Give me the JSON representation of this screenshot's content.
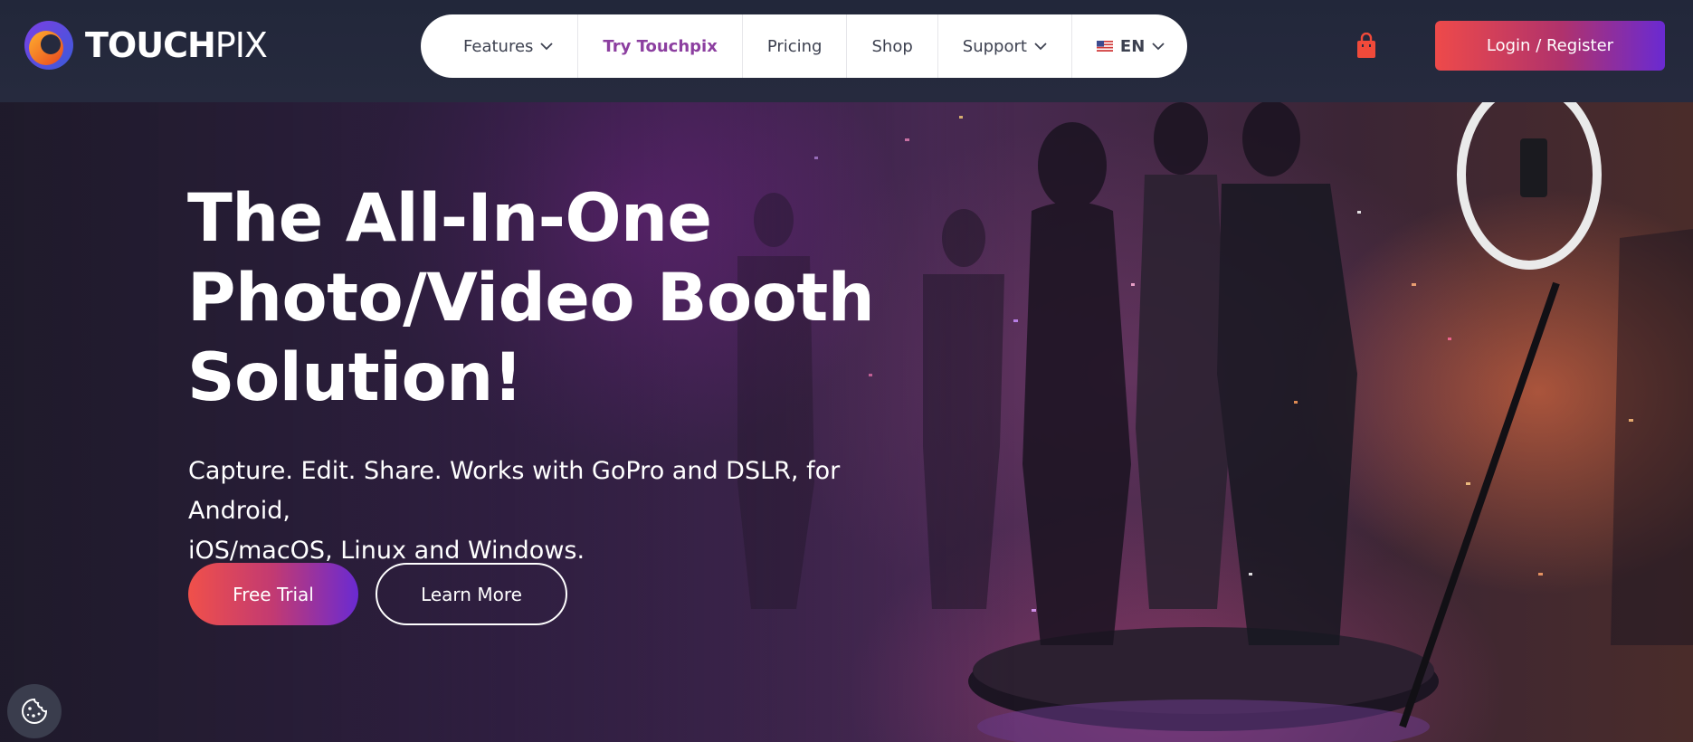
{
  "brand": {
    "name_strong": "TOUCH",
    "name_light": "PIX",
    "colors": {
      "orange": "#f07a1e",
      "purple": "#6a2ad2",
      "red": "#ee4a4a"
    }
  },
  "nav": {
    "items": [
      {
        "label": "Features",
        "icon": "chevron-down-icon"
      },
      {
        "label": "Try Touchpix"
      },
      {
        "label": "Pricing"
      },
      {
        "label": "Shop"
      },
      {
        "label": "Support",
        "icon": "chevron-down-icon"
      },
      {
        "label": "EN",
        "icon": "us-flag-icon"
      }
    ]
  },
  "header": {
    "cart_icon": "shopping-bag-icon",
    "login_label": "Login / Register"
  },
  "hero": {
    "headline_lines": [
      "The All-In-One",
      "Photo/Video Booth",
      "Solution!"
    ],
    "subtext_lines": [
      "Capture. Edit. Share. Works with GoPro and DSLR, for Android,",
      "iOS/macOS, Linux and Windows."
    ],
    "primary_cta": "Free Trial",
    "secondary_cta": "Learn More"
  },
  "cookie": {
    "icon": "cookie-icon"
  }
}
